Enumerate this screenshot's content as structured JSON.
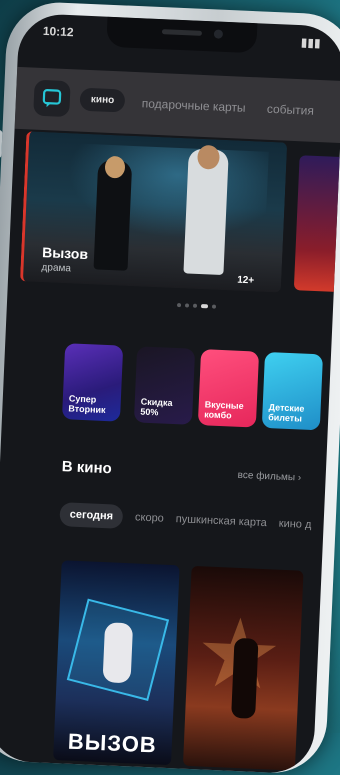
{
  "status_bar": {
    "time": "10:12"
  },
  "header": {
    "active_pill": "кино",
    "nav_items": [
      "подарочные карты",
      "события"
    ]
  },
  "hero": {
    "title": "Вызов",
    "subtitle": "драма",
    "age_rating": "12+",
    "pagination": {
      "count": 5,
      "active_index": 3
    }
  },
  "promo_tiles": [
    {
      "label": "Супер Вторник",
      "color": "#5a2fb8"
    },
    {
      "label": "Скидка 50%",
      "color": "#281b4a"
    },
    {
      "label": "Вкусные комбо",
      "color": "#ff4f7d"
    },
    {
      "label": "Детские билеты",
      "color": "#3fd0f0"
    }
  ],
  "section": {
    "title": "В кино",
    "link": "все фильмы",
    "chips": [
      "сегодня",
      "скоро",
      "пушкинская карта",
      "кино д"
    ],
    "active_chip": 0
  },
  "posters": [
    {
      "title": "ВЫЗОВ"
    },
    {
      "title": ""
    }
  ]
}
